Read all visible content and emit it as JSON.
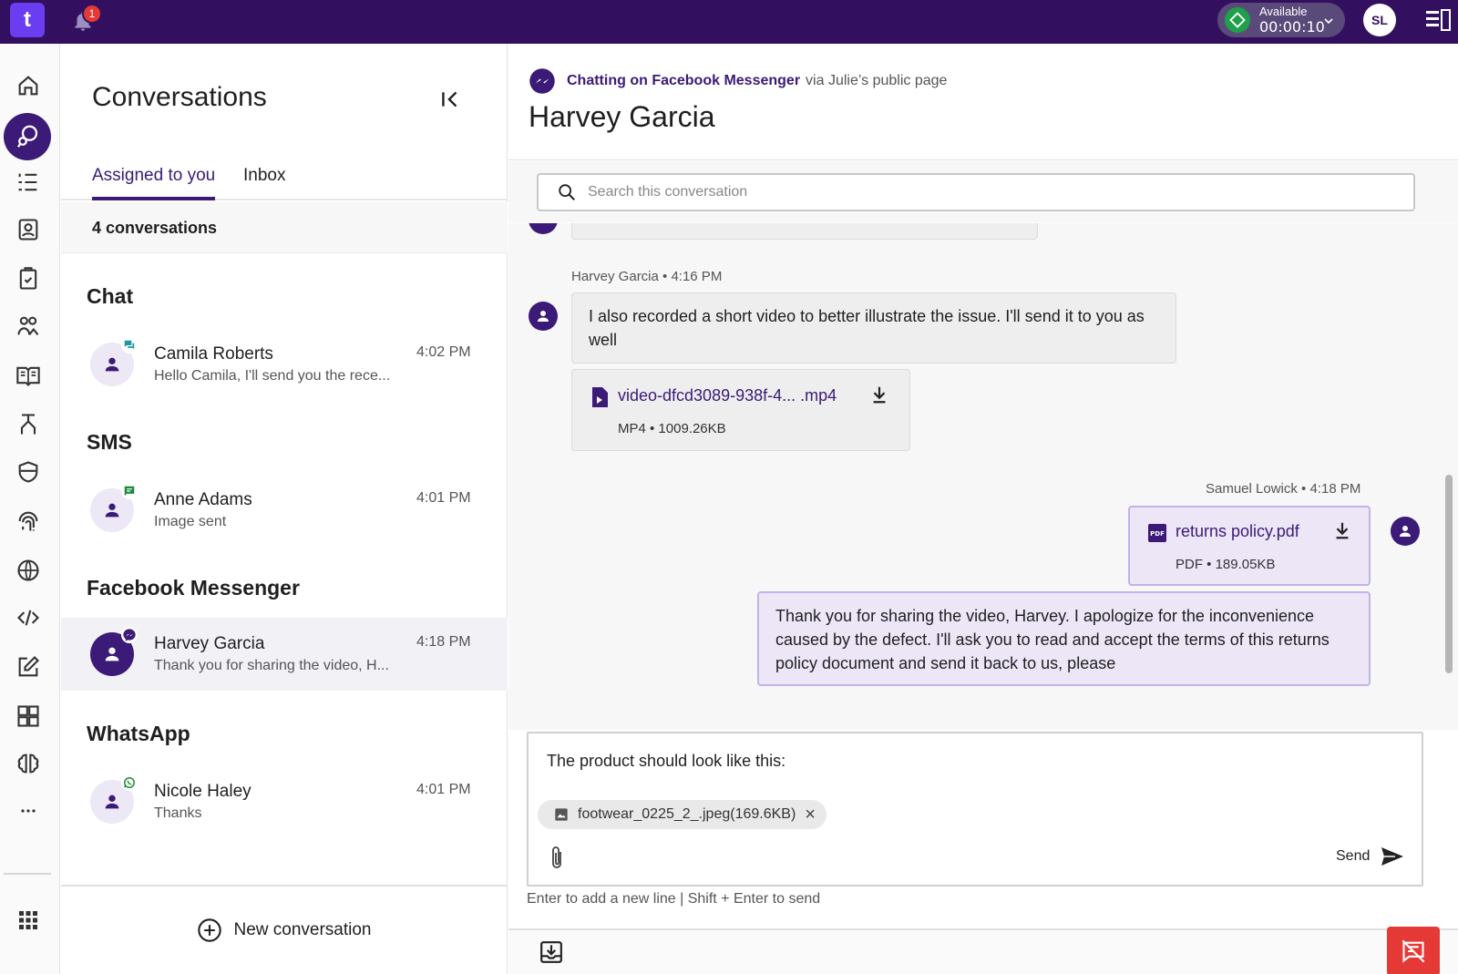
{
  "topbar": {
    "logo_text": "t",
    "notification_count": "1",
    "status_label": "Available",
    "status_timer": "00:00:10",
    "user_initials": "SL"
  },
  "conversations": {
    "title": "Conversations",
    "tabs": [
      {
        "label": "Assigned to you",
        "active": true
      },
      {
        "label": "Inbox",
        "active": false
      }
    ],
    "count_label": "4 conversations",
    "groups": [
      {
        "title": "Chat",
        "items": [
          {
            "name": "Camila Roberts",
            "preview": "Hello Camila, I'll send you the rece...",
            "time": "4:02 PM",
            "channel": "chat-icon"
          }
        ]
      },
      {
        "title": "SMS",
        "items": [
          {
            "name": "Anne Adams",
            "preview": "Image sent",
            "time": "4:01 PM",
            "channel": "sms-icon"
          }
        ]
      },
      {
        "title": "Facebook Messenger",
        "items": [
          {
            "name": "Harvey Garcia",
            "preview": "Thank you for sharing the video, H...",
            "time": "4:18 PM",
            "channel": "messenger-icon",
            "selected": true
          }
        ]
      },
      {
        "title": "WhatsApp",
        "items": [
          {
            "name": "Nicole Haley",
            "preview": "Thanks",
            "time": "4:01 PM",
            "channel": "whatsapp-icon"
          }
        ]
      }
    ],
    "new_conversation_label": "New conversation"
  },
  "chat": {
    "channel_strong": "Chatting on Facebook Messenger",
    "channel_via": "via Julie’s public page",
    "contact_name": "Harvey Garcia",
    "search_placeholder": "Search this conversation",
    "messages": [
      {
        "meta": "Harvey Garcia • 4:16 PM",
        "text": "I also recorded a short video to better illustrate the issue. I'll send it to you as well",
        "file_name": "video-dfcd3089-938f-4... .mp4",
        "file_meta": "MP4 • 1009.26KB"
      },
      {
        "meta": "Samuel Lowick • 4:18 PM",
        "file_name": "returns policy.pdf",
        "file_meta": "PDF • 189.05KB",
        "text": "Thank you for sharing the video, Harvey. I apologize for the inconvenience caused by the defect. I'll ask you to read and accept the terms of this returns policy document and send it back to us, please"
      }
    ],
    "composer_text": "The product should look like this:",
    "attachment_chip": "footwear_0225_2_.jpeg(169.6KB)",
    "send_label": "Send",
    "hint": "Enter to add a new line | Shift + Enter to send"
  },
  "colors": {
    "brand": "#32105f",
    "accent": "#3b1a78",
    "available": "#1fa04a",
    "danger": "#e53935"
  }
}
